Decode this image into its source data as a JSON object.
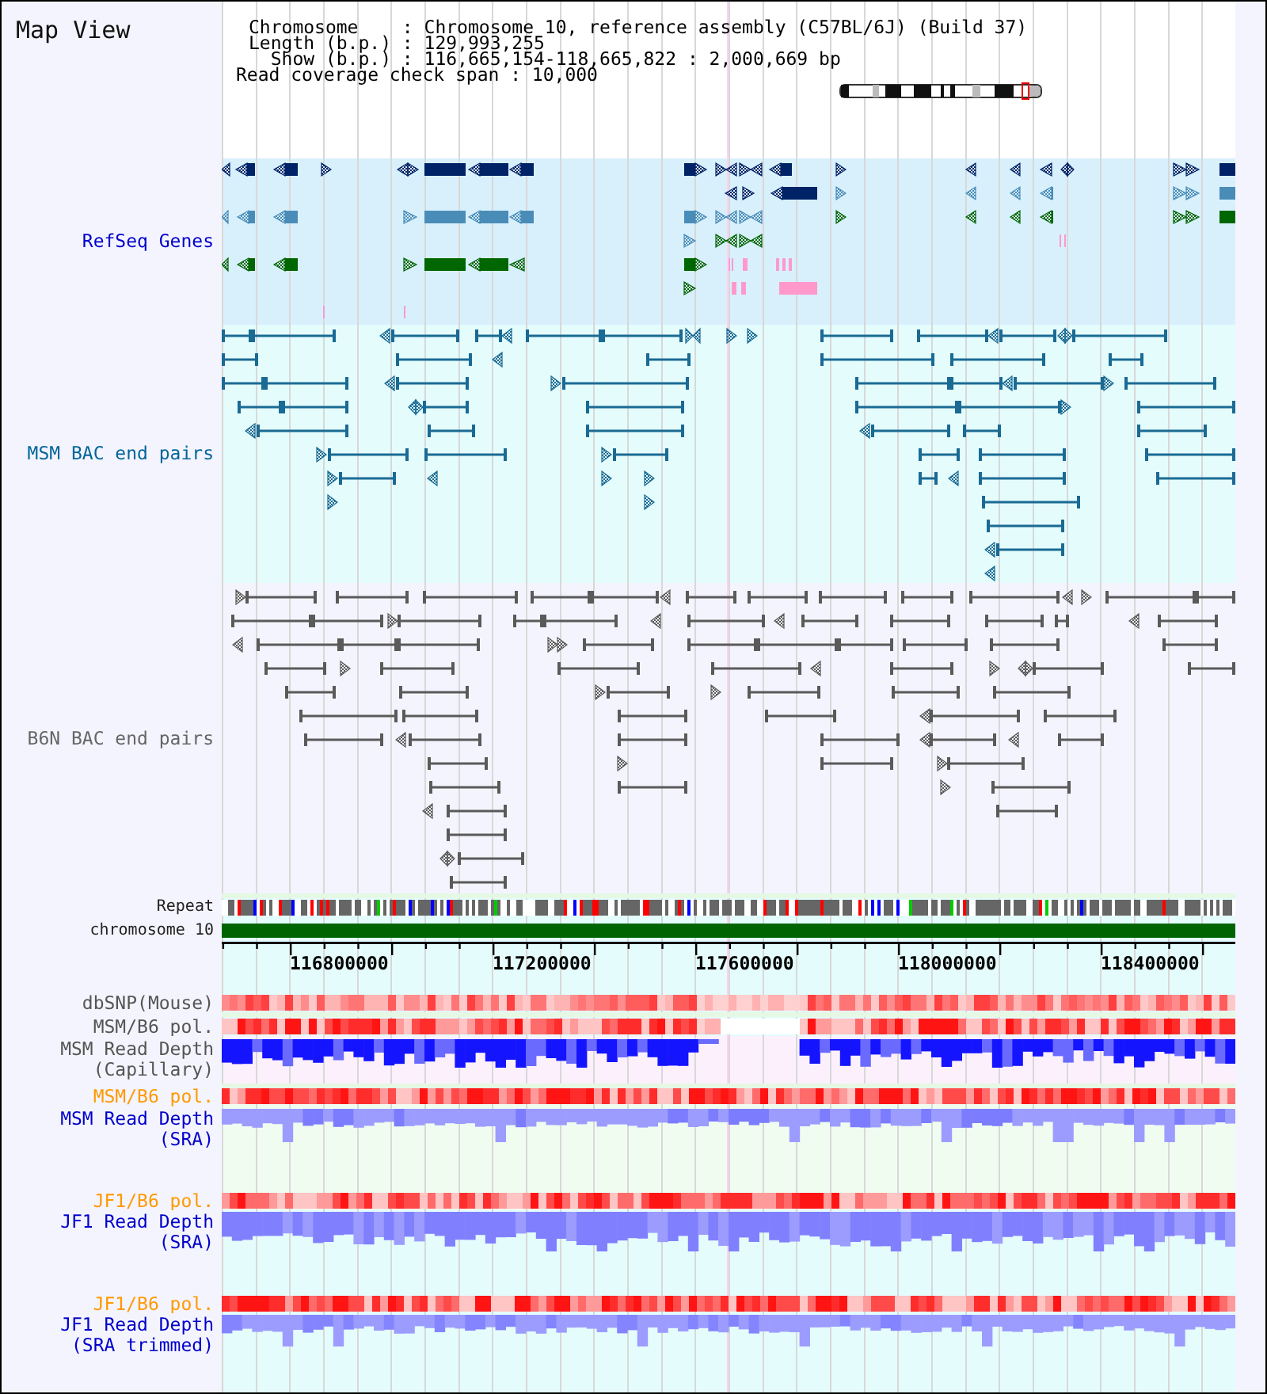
{
  "title": "Map View",
  "info": {
    "lines": [
      "Chromosome    : Chromosome 10, reference assembly (C57BL/6J) (Build 37)",
      "Length (b.p.) : 129,993,255",
      "  Show (b.p.) : 116,665,154-118,665,822 : 2,000,669 bp"
    ],
    "span_line": "Read coverage check span : 10,000"
  },
  "tracks": [
    {
      "kind": "genes",
      "label_lines": [
        "RefSeq Genes"
      ],
      "color": "#0000cc"
    },
    {
      "kind": "bac_pairs",
      "label_lines": [
        "MSM BAC end pairs"
      ],
      "color": "#006699"
    },
    {
      "kind": "bac_pairs",
      "label_lines": [
        "B6N BAC end pairs"
      ],
      "color": "#666666"
    },
    {
      "kind": "repeat",
      "label_lines": [
        "Repeat"
      ],
      "color": "#222222"
    },
    {
      "kind": "chromosome",
      "label_lines": [
        "chromosome 10"
      ],
      "color": "#222222"
    },
    {
      "kind": "ruler",
      "tick_labels": [
        "116800000",
        "117200000",
        "117600000",
        "118000000",
        "118400000"
      ]
    },
    {
      "kind": "heat",
      "label_lines": [
        "dbSNP(Mouse)"
      ],
      "color": "#555555"
    },
    {
      "kind": "heat",
      "label_lines": [
        "MSM/B6 pol."
      ],
      "color": "#555555"
    },
    {
      "kind": "depth",
      "label_lines": [
        "MSM Read Depth",
        "(Capillary)"
      ],
      "color": "#555555"
    },
    {
      "kind": "heat",
      "label_lines": [
        "MSM/B6 pol."
      ],
      "color": "#ff9900"
    },
    {
      "kind": "depth",
      "label_lines": [
        "MSM Read Depth",
        "(SRA)"
      ],
      "color": "#0000cc"
    },
    {
      "kind": "heat",
      "label_lines": [
        "JF1/B6 pol."
      ],
      "color": "#ff9900"
    },
    {
      "kind": "depth",
      "label_lines": [
        "JF1 Read Depth",
        "(SRA)"
      ],
      "color": "#0000cc"
    },
    {
      "kind": "heat",
      "label_lines": [
        "JF1/B6 pol."
      ],
      "color": "#ff9900"
    },
    {
      "kind": "depth",
      "label_lines": [
        "JF1 Read Depth",
        "(SRA trimmed)"
      ],
      "color": "#0000cc"
    }
  ]
}
